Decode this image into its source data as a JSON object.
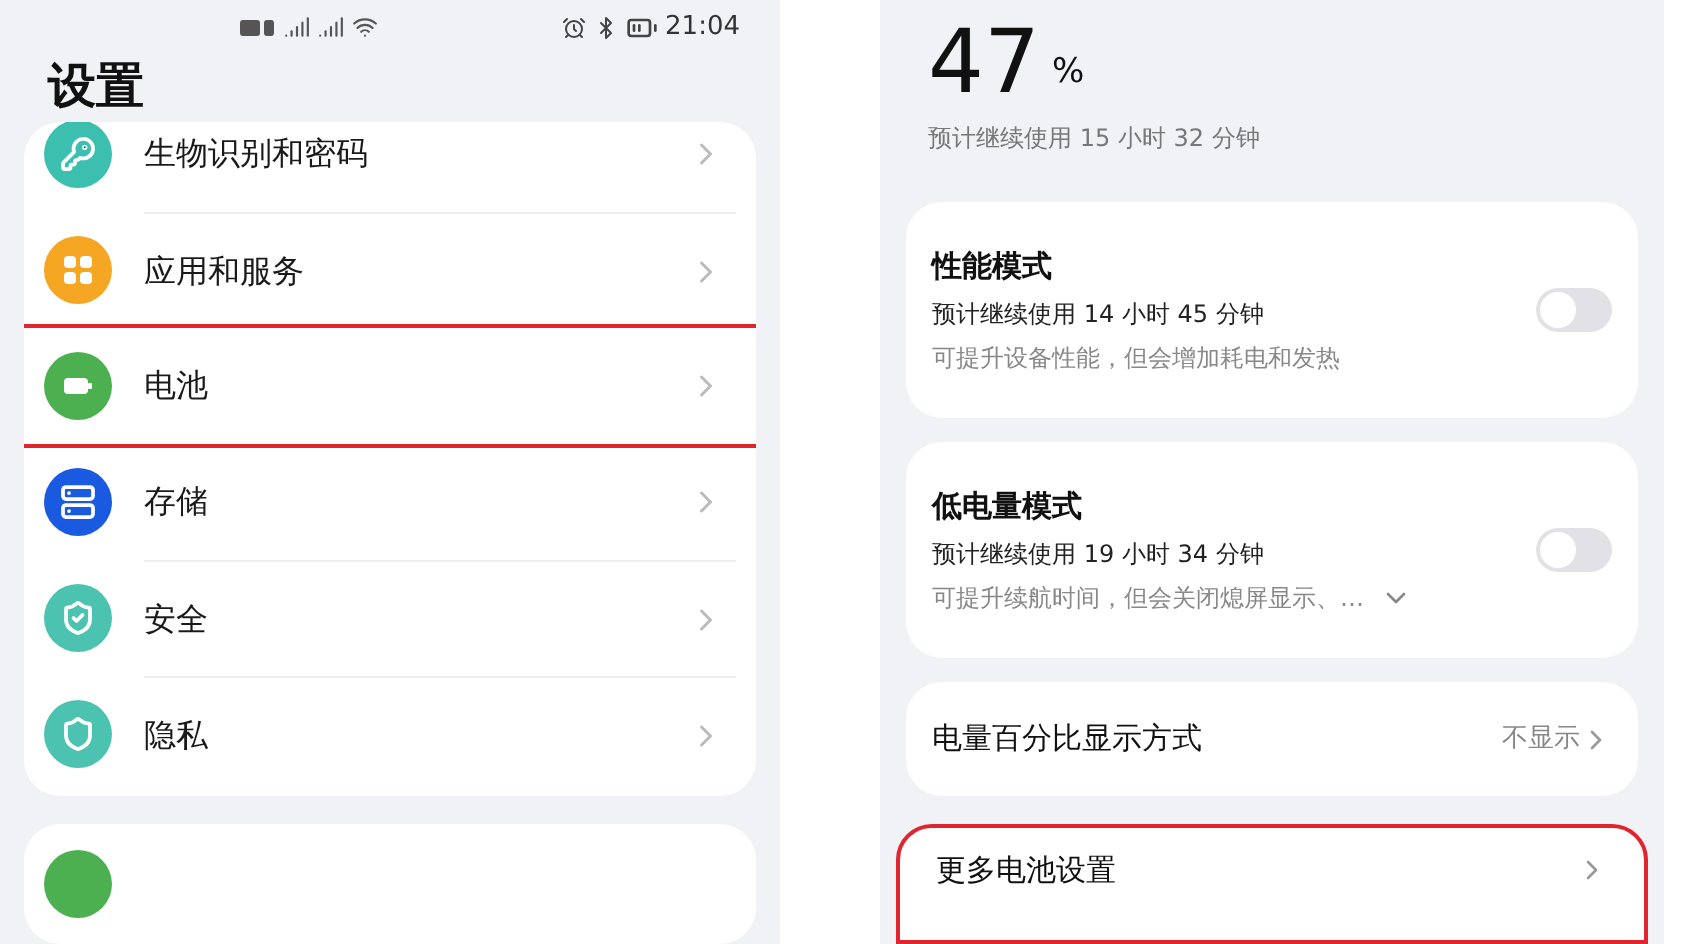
{
  "left_screen": {
    "status_bar": {
      "time": "21:04"
    },
    "title": "设置",
    "items": [
      {
        "label": "生物识别和密码",
        "color": "#3cbfae",
        "highlighted": false
      },
      {
        "label": "应用和服务",
        "color": "#f5a623",
        "highlighted": false
      },
      {
        "label": "电池",
        "color": "#4caf50",
        "highlighted": true
      },
      {
        "label": "存储",
        "color": "#1a5ae0",
        "highlighted": false
      },
      {
        "label": "安全",
        "color": "#4cc3b0",
        "highlighted": false
      },
      {
        "label": "隐私",
        "color": "#4cc3b0",
        "highlighted": false
      }
    ],
    "next_card_item": {
      "color": "#4caf50"
    }
  },
  "right_screen": {
    "battery": {
      "percent": "47",
      "unit": "%",
      "estimate": "预计继续使用 15 小时 32 分钟"
    },
    "modes": [
      {
        "title": "性能模式",
        "estimate": "预计继续使用 14 小时 45 分钟",
        "description": "可提升设备性能，但会增加耗电和发热",
        "on": false,
        "expandable": false
      },
      {
        "title": "低电量模式",
        "estimate": "预计继续使用 19 小时 34 分钟",
        "description": "可提升续航时间，但会关闭熄屏显示、…",
        "on": false,
        "expandable": true
      }
    ],
    "percentage_display": {
      "label": "电量百分比显示方式",
      "value": "不显示"
    },
    "more_settings": {
      "label": "更多电池设置",
      "highlighted": true
    }
  }
}
